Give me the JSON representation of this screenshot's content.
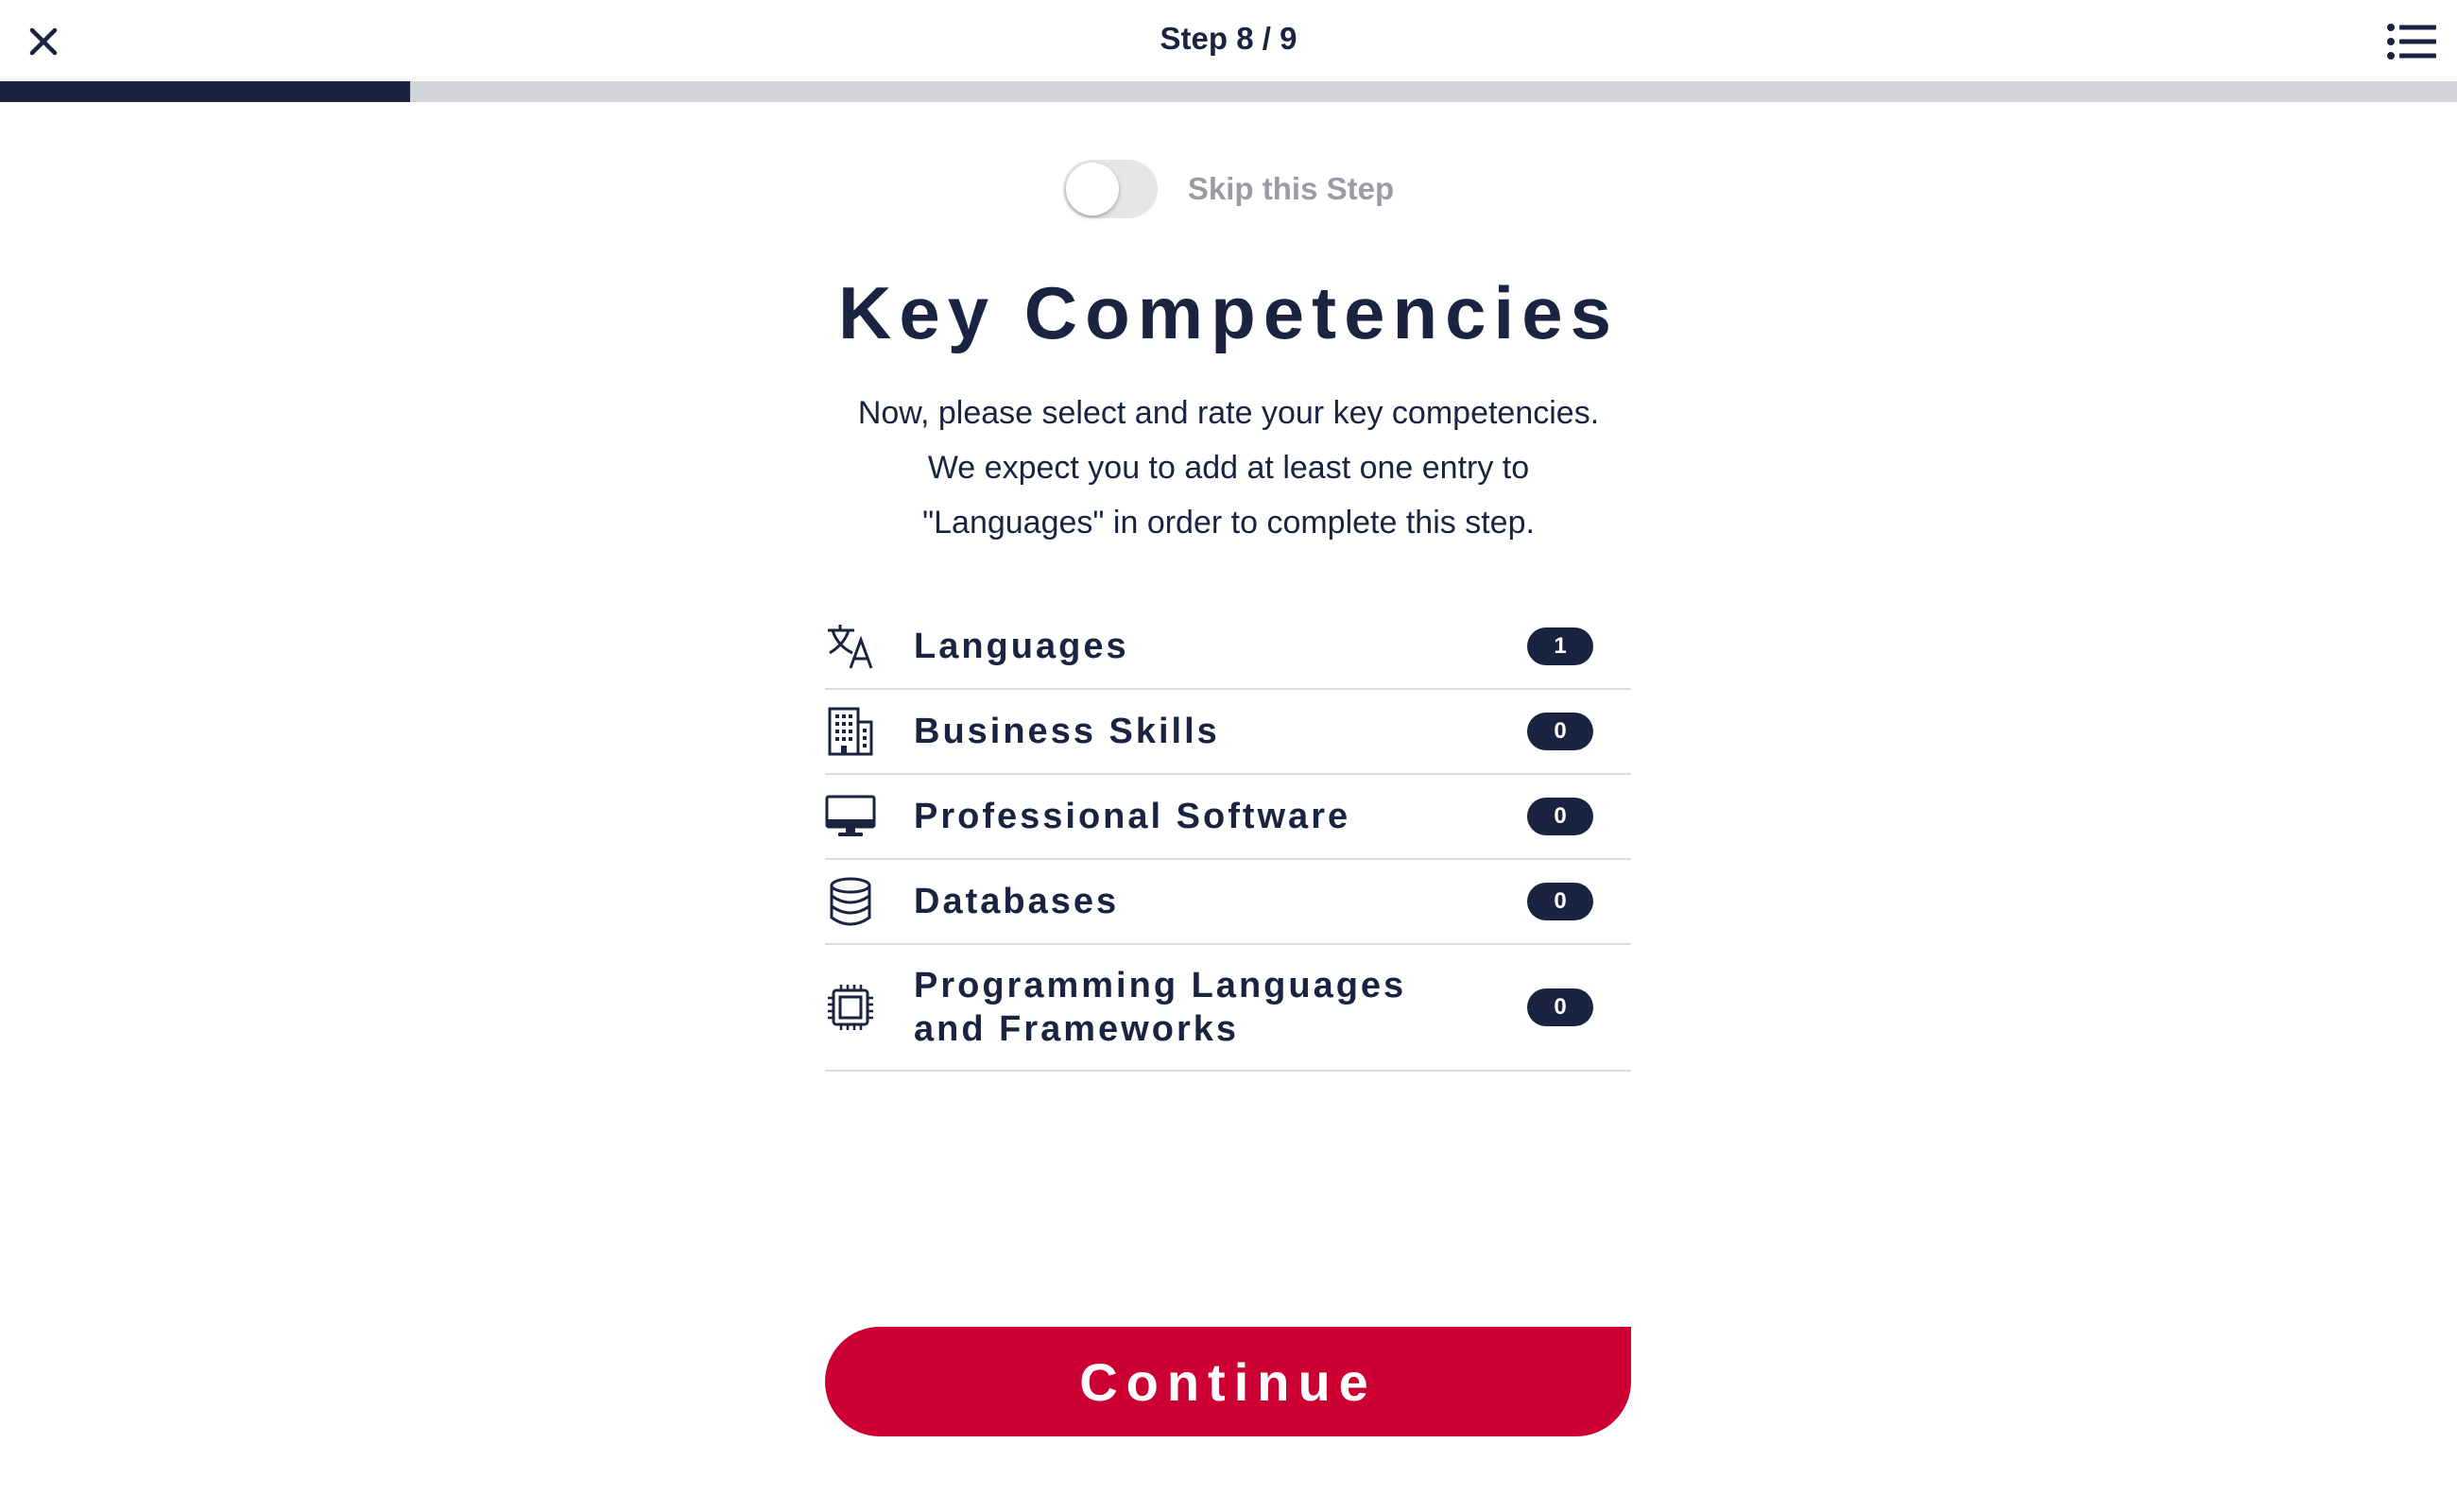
{
  "header": {
    "step_label": "Step 8 / 9",
    "close_icon": "close-icon",
    "menu_icon": "list-menu-icon"
  },
  "progress": {
    "current_step": 8,
    "total_steps": 9,
    "fill_fraction": 0.167
  },
  "skip": {
    "label": "Skip this Step",
    "enabled": false
  },
  "main": {
    "title": "Key Competencies",
    "description_lines": [
      "Now, please select and rate your key competencies.",
      "We expect you to add at least one entry to",
      "\"Languages\" in order to complete this step."
    ]
  },
  "competencies": [
    {
      "label": "Languages",
      "count": "1",
      "icon": "translate-icon"
    },
    {
      "label": "Business Skills",
      "count": "0",
      "icon": "building-icon"
    },
    {
      "label": "Professional Software",
      "count": "0",
      "icon": "monitor-icon"
    },
    {
      "label": "Databases",
      "count": "0",
      "icon": "database-icon"
    },
    {
      "label": "Programming Languages and Frameworks",
      "count": "0",
      "icon": "cpu-chip-icon"
    }
  ],
  "actions": {
    "continue_label": "Continue"
  },
  "colors": {
    "navy": "#1a2340",
    "accent_red": "#cc0033",
    "track_gray": "#d3d4da"
  }
}
